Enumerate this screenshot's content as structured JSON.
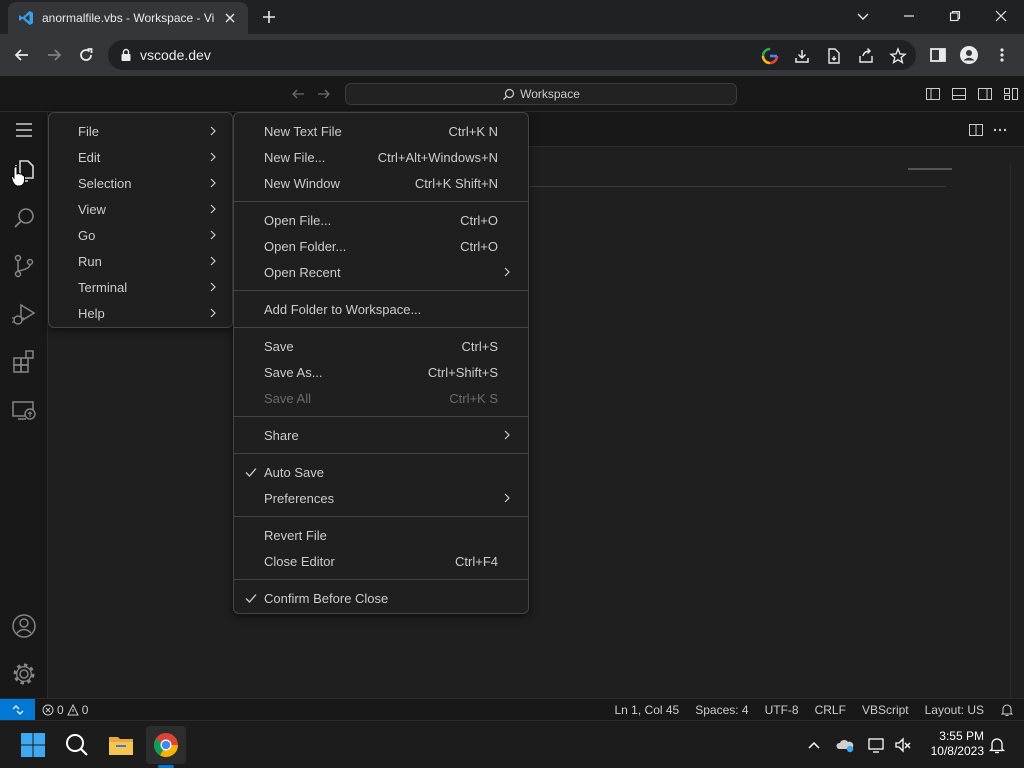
{
  "browser": {
    "tab_title": "anormalfile.vbs - Workspace - Vi",
    "url": "vscode.dev"
  },
  "vscode": {
    "command_center": "Workspace",
    "main_menu": [
      {
        "label": "File"
      },
      {
        "label": "Edit"
      },
      {
        "label": "Selection"
      },
      {
        "label": "View"
      },
      {
        "label": "Go"
      },
      {
        "label": "Run"
      },
      {
        "label": "Terminal"
      },
      {
        "label": "Help"
      }
    ],
    "file_menu": {
      "new_text_file": {
        "label": "New Text File",
        "kb": "Ctrl+K N"
      },
      "new_file": {
        "label": "New File...",
        "kb": "Ctrl+Alt+Windows+N"
      },
      "new_window": {
        "label": "New Window",
        "kb": "Ctrl+K Shift+N"
      },
      "open_file": {
        "label": "Open File...",
        "kb": "Ctrl+O"
      },
      "open_folder": {
        "label": "Open Folder...",
        "kb": "Ctrl+O"
      },
      "open_recent": {
        "label": "Open Recent"
      },
      "add_folder": {
        "label": "Add Folder to Workspace..."
      },
      "save": {
        "label": "Save",
        "kb": "Ctrl+S"
      },
      "save_as": {
        "label": "Save As...",
        "kb": "Ctrl+Shift+S"
      },
      "save_all": {
        "label": "Save All",
        "kb": "Ctrl+K S"
      },
      "share": {
        "label": "Share"
      },
      "auto_save": {
        "label": "Auto Save"
      },
      "preferences": {
        "label": "Preferences"
      },
      "revert_file": {
        "label": "Revert File"
      },
      "close_editor": {
        "label": "Close Editor",
        "kb": "Ctrl+F4"
      },
      "confirm_before_close": {
        "label": "Confirm Before Close"
      }
    },
    "status": {
      "errors": "0",
      "warnings": "0",
      "position": "Ln 1, Col 45",
      "spaces": "Spaces: 4",
      "encoding": "UTF-8",
      "eol": "CRLF",
      "language": "VBScript",
      "layout": "Layout: US"
    }
  },
  "taskbar": {
    "time": "3:55 PM",
    "date": "10/8/2023"
  },
  "colors": {
    "accent": "#0078d4",
    "menu_bg": "#1f1f1f",
    "menu_border": "#454545"
  }
}
